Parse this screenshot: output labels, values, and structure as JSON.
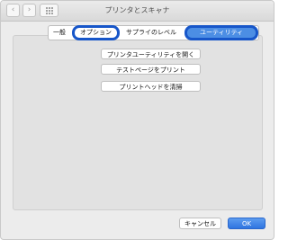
{
  "window": {
    "title": "プリンタとスキャナ"
  },
  "toolbar": {
    "back_icon": "chevron-left-icon",
    "forward_icon": "chevron-right-icon",
    "grid_icon": "grid-icon"
  },
  "tabs": [
    {
      "label": "一般",
      "selected": false
    },
    {
      "label": "オプション",
      "selected": false
    },
    {
      "label": "サプライのレベル",
      "selected": false
    },
    {
      "label": "ユーティリティ",
      "selected": true
    }
  ],
  "actions": [
    {
      "label": "プリンタユーティリティを開く"
    },
    {
      "label": "テストページをプリント"
    },
    {
      "label": "プリントヘッドを清掃"
    }
  ],
  "footer": {
    "cancel_label": "キャンセル",
    "ok_label": "OK"
  },
  "colors": {
    "accent": "#4c8ee4",
    "highlight": "#1756c9"
  }
}
